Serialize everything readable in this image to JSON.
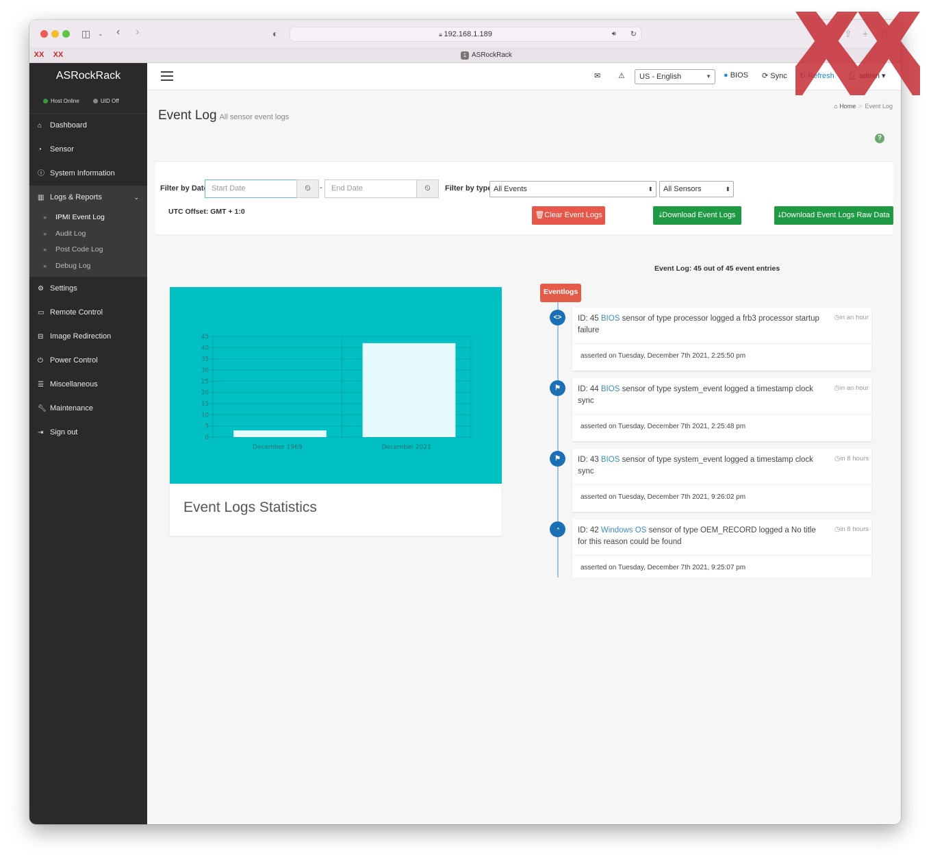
{
  "browser": {
    "url": "192.168.1.189",
    "tab_title": "ASRockRack",
    "tab_number": "1",
    "pinned_tabs": [
      "XX",
      "XX"
    ]
  },
  "sidebar": {
    "brand": "ASRockRack",
    "status": {
      "host": "Host Online",
      "uid": "UID Off",
      "host_color": "#3c9a3c",
      "uid_color": "#888888"
    },
    "items": [
      {
        "label": "Dashboard",
        "icon": "home-icon"
      },
      {
        "label": "Sensor",
        "icon": "dashboard-icon"
      },
      {
        "label": "System Information",
        "icon": "info-icon"
      },
      {
        "label": "Logs & Reports",
        "icon": "bar-chart-icon"
      },
      {
        "label": "Settings",
        "icon": "gear-icon"
      },
      {
        "label": "Remote Control",
        "icon": "monitor-icon"
      },
      {
        "label": "Image Redirection",
        "icon": "disk-icon"
      },
      {
        "label": "Power Control",
        "icon": "power-icon"
      },
      {
        "label": "Miscellaneous",
        "icon": "list-icon"
      },
      {
        "label": "Maintenance",
        "icon": "wrench-icon"
      },
      {
        "label": "Sign out",
        "icon": "sign-out-icon"
      }
    ],
    "sub_items": [
      "IPMI Event Log",
      "Audit Log",
      "Post Code Log",
      "Debug Log"
    ]
  },
  "topbar": {
    "language": "US - English",
    "bios": "BIOS",
    "sync": "Sync",
    "refresh": "Refresh",
    "user": "admin"
  },
  "page": {
    "title": "Event Log",
    "subtitle": "All sensor event logs",
    "breadcrumb": {
      "home": "Home",
      "current": "Event Log"
    },
    "help": "?"
  },
  "filter": {
    "by_date_label": "Filter by Date",
    "start_placeholder": "Start Date",
    "end_placeholder": "End Date",
    "dash": "-",
    "by_type_label": "Filter by type",
    "type_selected": "All Events",
    "sensor_selected": "All Sensors",
    "utc_offset": "UTC Offset: GMT + 1:0",
    "clear_button": "Clear Event Logs",
    "download_button": "Download Event Logs",
    "download_raw_button": "Download Event Logs Raw Data"
  },
  "entries_info": "Event Log: 45 out of 45 event entries",
  "chart_data": {
    "type": "bar",
    "categories": [
      "December 1969",
      "December 2021"
    ],
    "values": [
      3,
      42
    ],
    "ylim": [
      0,
      45
    ],
    "yticks": [
      0,
      5,
      10,
      15,
      20,
      25,
      30,
      35,
      40,
      45
    ],
    "grid": true,
    "background": "#00c0c3",
    "bar_color": "#e6fbfb",
    "caption": "Event Logs Statistics"
  },
  "timeline": {
    "badge": "Eventlogs",
    "entries": [
      {
        "id": "ID: 45",
        "source": "BIOS",
        "message": "sensor of type processor logged a frb3 processor startup failure",
        "time": "in an hour",
        "asserted": "asserted on Tuesday, December 7th 2021, 2:25:50 pm",
        "icon": "processor-icon",
        "glyph": "<>"
      },
      {
        "id": "ID: 44",
        "source": "BIOS",
        "message": "sensor of type system_event logged a timestamp clock sync",
        "time": "in an hour",
        "asserted": "asserted on Tuesday, December 7th 2021, 2:25:48 pm",
        "icon": "flag-icon",
        "glyph": "⚑"
      },
      {
        "id": "ID: 43",
        "source": "BIOS",
        "message": "sensor of type system_event logged a timestamp clock sync",
        "time": "in 8 hours",
        "asserted": "asserted on Tuesday, December 7th 2021, 9:26:02 pm",
        "icon": "flag-icon",
        "glyph": "⚑"
      },
      {
        "id": "ID: 42",
        "source": "Windows OS",
        "message": "sensor of type OEM_RECORD logged a No title for this reason could be found",
        "time": "in 8 hours",
        "asserted": "asserted on Tuesday, December 7th 2021, 9:25:07 pm",
        "icon": "dashboard-icon",
        "glyph": "◔"
      }
    ]
  }
}
